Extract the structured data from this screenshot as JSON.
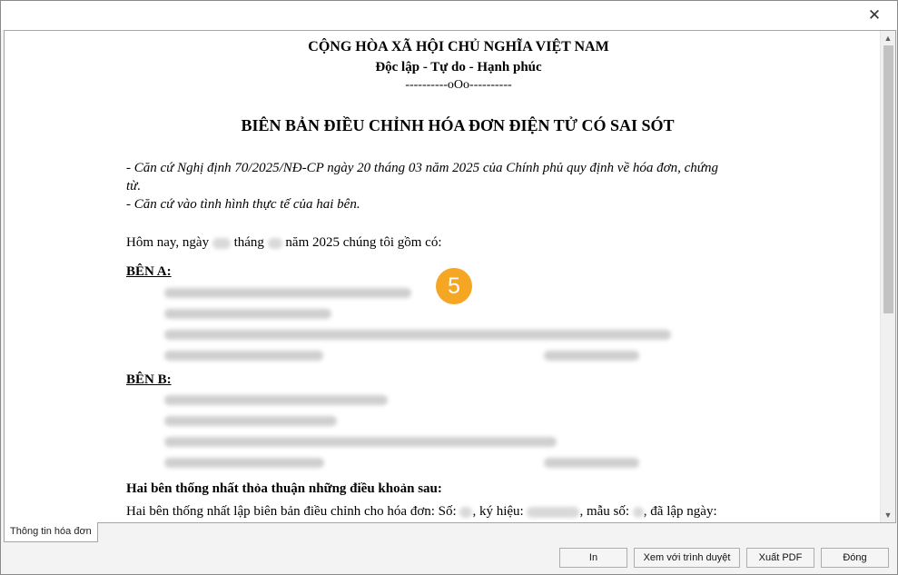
{
  "window": {
    "close_glyph": "✕"
  },
  "document": {
    "country": "CỘNG HÒA XÃ HỘI CHỦ NGHĨA VIỆT NAM",
    "motto": "Độc lập - Tự do - Hạnh phúc",
    "separator": "----------oOo----------",
    "title": "BIÊN BẢN ĐIỀU CHỈNH HÓA ĐƠN ĐIỆN TỬ CÓ SAI SÓT",
    "basis_1_line_1": "- Căn cứ Nghị định 70/2025/NĐ-CP ngày 20 tháng 03 năm 2025 của Chính phủ quy định về hóa đơn, chứng",
    "basis_1_line_2": "từ.",
    "basis_2": "- Căn cứ vào tình hình thực tế của hai bên.",
    "today_prefix": "Hôm nay, ngày",
    "today_month": "tháng",
    "today_year": "năm 2025 chúng tôi gồm có:",
    "party_a": "BÊN A:",
    "party_b": "BÊN B:",
    "agreement_heading": "Hai bên thống nhất thỏa thuận những điều khoản sau:",
    "agreement_prefix": "Hai bên thống nhất lập biên bản điều chỉnh cho hóa đơn: Số:",
    "agreement_symbol": ", ký hiệu:",
    "agreement_form": ", mẫu số:",
    "agreement_date": ", đã lập ngày:"
  },
  "badge": {
    "number": "5"
  },
  "tab": {
    "label": "Thông tin hóa đơn"
  },
  "buttons": {
    "print": "In",
    "browser": "Xem với trình duyệt",
    "pdf": "Xuất PDF",
    "close": "Đóng"
  }
}
